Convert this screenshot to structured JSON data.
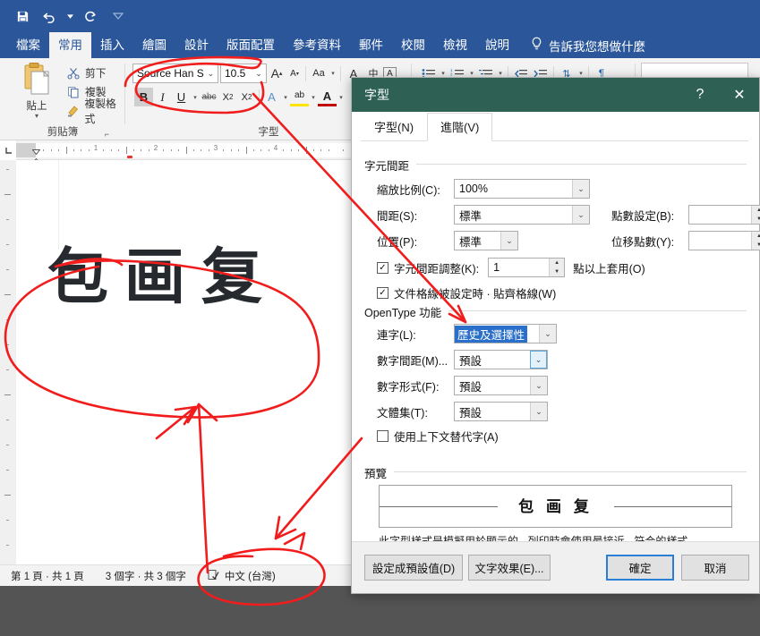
{
  "window": {
    "quick_access": [
      "save-icon",
      "undo-icon",
      "redo-icon",
      "customize-qat-icon"
    ]
  },
  "ribbon": {
    "tabs": [
      {
        "label": "檔案",
        "active": false
      },
      {
        "label": "常用",
        "active": true
      },
      {
        "label": "插入",
        "active": false
      },
      {
        "label": "繪圖",
        "active": false
      },
      {
        "label": "設計",
        "active": false
      },
      {
        "label": "版面配置",
        "active": false
      },
      {
        "label": "參考資料",
        "active": false
      },
      {
        "label": "郵件",
        "active": false
      },
      {
        "label": "校閱",
        "active": false
      },
      {
        "label": "檢視",
        "active": false
      },
      {
        "label": "說明",
        "active": false
      }
    ],
    "tell_me": "告訴我您想做什麼",
    "tell_me_icon": "lightbulb-icon",
    "groups": {
      "clipboard": {
        "label": "剪貼簿",
        "paste": "貼上",
        "items": [
          {
            "label": "剪下",
            "icon": "scissors-icon"
          },
          {
            "label": "複製",
            "icon": "copy-icon"
          },
          {
            "label": "複製格式",
            "icon": "format-painter-icon"
          }
        ]
      },
      "font": {
        "label": "字型",
        "font_name": "Source Han S",
        "font_size": "10.5",
        "buttons": [
          "B",
          "I",
          "U",
          "abc",
          "X₂",
          "X²"
        ]
      }
    }
  },
  "ruler": {
    "numbers": [
      "1",
      "2",
      "3",
      "4"
    ]
  },
  "document": {
    "text": "包画复"
  },
  "statusbar": {
    "page": "第 1 頁 · 共 1 頁",
    "words": "3 個字 · 共 3 個字",
    "proofing_icon": "proofing-icon",
    "language": "中文 (台灣)"
  },
  "dialog": {
    "title": "字型",
    "help_label": "?",
    "close_label": "✕",
    "tabs": [
      {
        "label": "字型(N)",
        "active": false
      },
      {
        "label": "進階(V)",
        "active": true
      }
    ],
    "char_spacing": {
      "group_title": "字元間距",
      "scale_label": "縮放比例(C):",
      "scale_value": "100%",
      "spacing_label": "間距(S):",
      "spacing_value": "標準",
      "by_label_1": "點數設定(B):",
      "by_value_1": "",
      "position_label": "位置(P):",
      "position_value": "標準",
      "by_label_2": "位移點數(Y):",
      "by_value_2": "",
      "kerning_label": "字元間距調整(K):",
      "kerning_value": "1",
      "kerning_checked": true,
      "kerning_suffix": "點以上套用(O)",
      "grid_label": "文件格線被設定時 · 貼齊格線(W)",
      "grid_checked": true
    },
    "opentype": {
      "group_title": "OpenType 功能",
      "ligatures_label": "連字(L):",
      "ligatures_value": "歷史及選擇性",
      "number_spacing_label": "數字間距(M)...",
      "number_spacing_value": "預設",
      "number_forms_label": "數字形式(F):",
      "number_forms_value": "預設",
      "stylistic_sets_label": "文體集(T):",
      "stylistic_sets_value": "預設",
      "contextual_label": "使用上下文替代字(A)",
      "contextual_checked": false
    },
    "preview": {
      "group_title": "預覽",
      "sample_text": "包 画 复",
      "note": "此字型樣式是模擬用於顯示的 · 列印時會使用最接近 · 符合的樣式 ·"
    },
    "footer": {
      "set_default": "設定成預設值(D)",
      "text_effects": "文字效果(E)...",
      "ok": "確定",
      "cancel": "取消"
    }
  },
  "colors": {
    "word_blue": "#2b579a",
    "dialog_teal": "#2e6054",
    "selection_blue": "#2a6fc9",
    "annotation_red": "#f02020",
    "desktop_gray": "#545454"
  }
}
